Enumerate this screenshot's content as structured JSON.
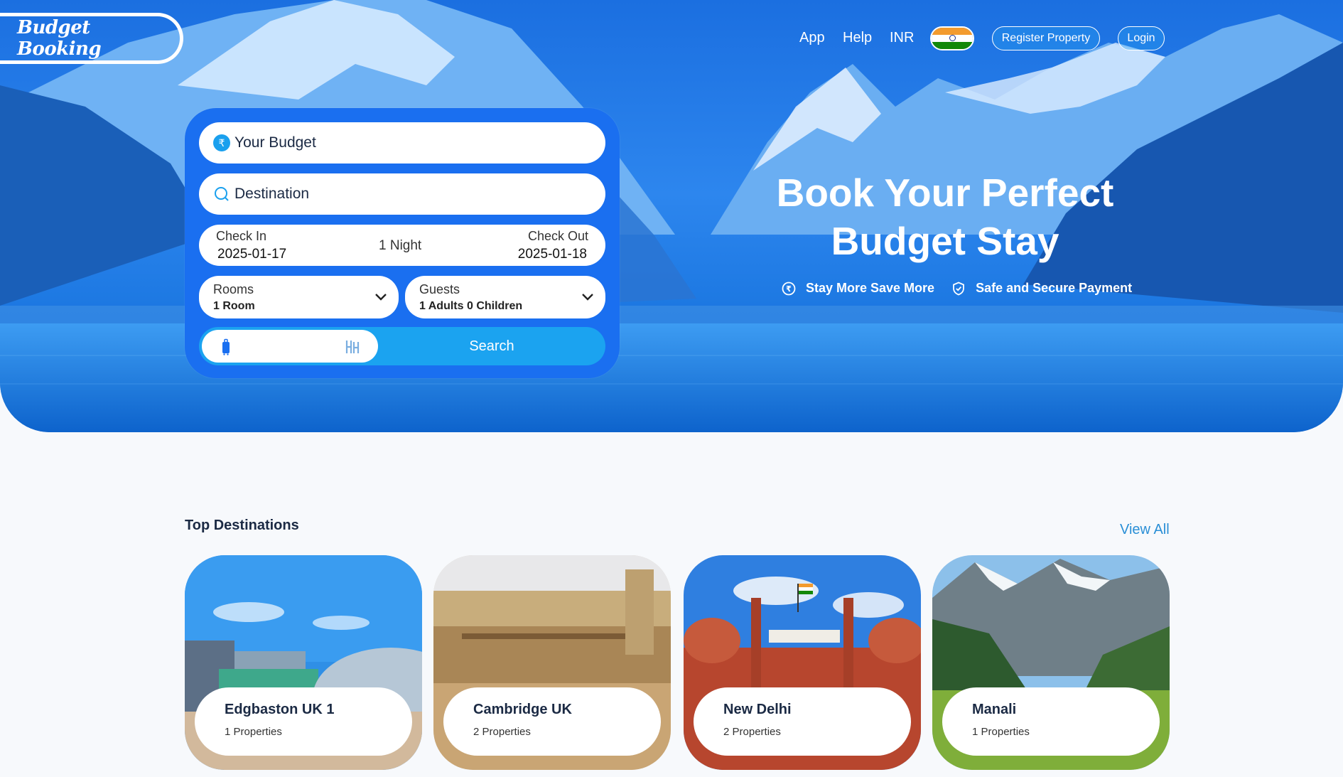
{
  "brand": {
    "logo_text": "Budget Booking"
  },
  "nav": {
    "app": "App",
    "help": "Help",
    "currency": "INR",
    "flag_icon": "india-flag-icon",
    "register_property": "Register Property",
    "login": "Login"
  },
  "hero": {
    "headline_line1": "Book Your Perfect",
    "headline_line2": "Budget Stay",
    "features": [
      "Stay More Save More",
      "Safe and Secure Payment"
    ]
  },
  "search": {
    "budget_label": "Your Budget",
    "destination_label": "Destination",
    "check_in_label": "Check In",
    "check_in_value": "2025-01-17",
    "nights": "1 Night",
    "check_out_label": "Check Out",
    "check_out_value": "2025-01-18",
    "rooms_label": "Rooms",
    "rooms_value": "1 Room",
    "guests_label": "Guests",
    "guests_value": "1 Adults 0 Children",
    "search_button": "Search"
  },
  "destinations": {
    "title": "Top Destinations",
    "view_all": "View All",
    "items": [
      {
        "name": "Edgbaston UK 1",
        "count": "1 Properties"
      },
      {
        "name": "Cambridge UK",
        "count": "2 Properties"
      },
      {
        "name": "New Delhi",
        "count": "2 Properties"
      },
      {
        "name": "Manali",
        "count": "1 Properties"
      }
    ]
  },
  "colors": {
    "hero_blue": "#1b6fe0",
    "panel_blue": "#1a6ff0",
    "search_blue": "#1ba3f0",
    "link_blue": "#2a8fd6",
    "heading": "#1b2a44"
  }
}
